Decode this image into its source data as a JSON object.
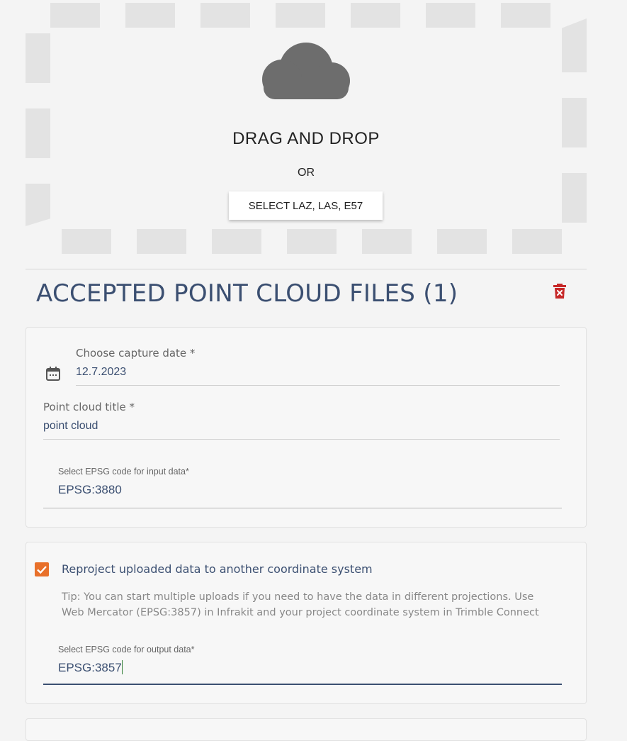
{
  "dropzone": {
    "title": "DRAG AND DROP",
    "or_text": "OR",
    "select_button_label": "SELECT LAZ, LAS, E57"
  },
  "section": {
    "title": "ACCEPTED POINT CLOUD FILES (1)"
  },
  "file_card": {
    "capture_date_label": "Choose capture date *",
    "capture_date_value": "12.7.2023",
    "title_label": "Point cloud title *",
    "title_value": "point cloud",
    "input_epsg_label": "Select EPSG code for input data*",
    "input_epsg_value": "EPSG:3880"
  },
  "reproject_card": {
    "checked": true,
    "label": "Reproject uploaded data to another coordinate system",
    "tip": "Tip: You can start multiple uploads if you need to have the data in different projections. Use Web Mercator (EPSG:3857) in Infrakit and your project coordinate system in Trimble Connect",
    "output_epsg_label": "Select EPSG code for output data*",
    "output_epsg_value": "EPSG:3857"
  },
  "icons": {
    "cloud": "cloud-upload-icon",
    "trash": "delete-icon",
    "calendar": "calendar-icon",
    "checkbox": "check-icon"
  },
  "colors": {
    "accent_orange": "#e8702a",
    "text_blue": "#3b4f71",
    "delete_red": "#c62828",
    "cloud_gray": "#6d6d6d",
    "dash_gray": "#e3e3e3"
  }
}
